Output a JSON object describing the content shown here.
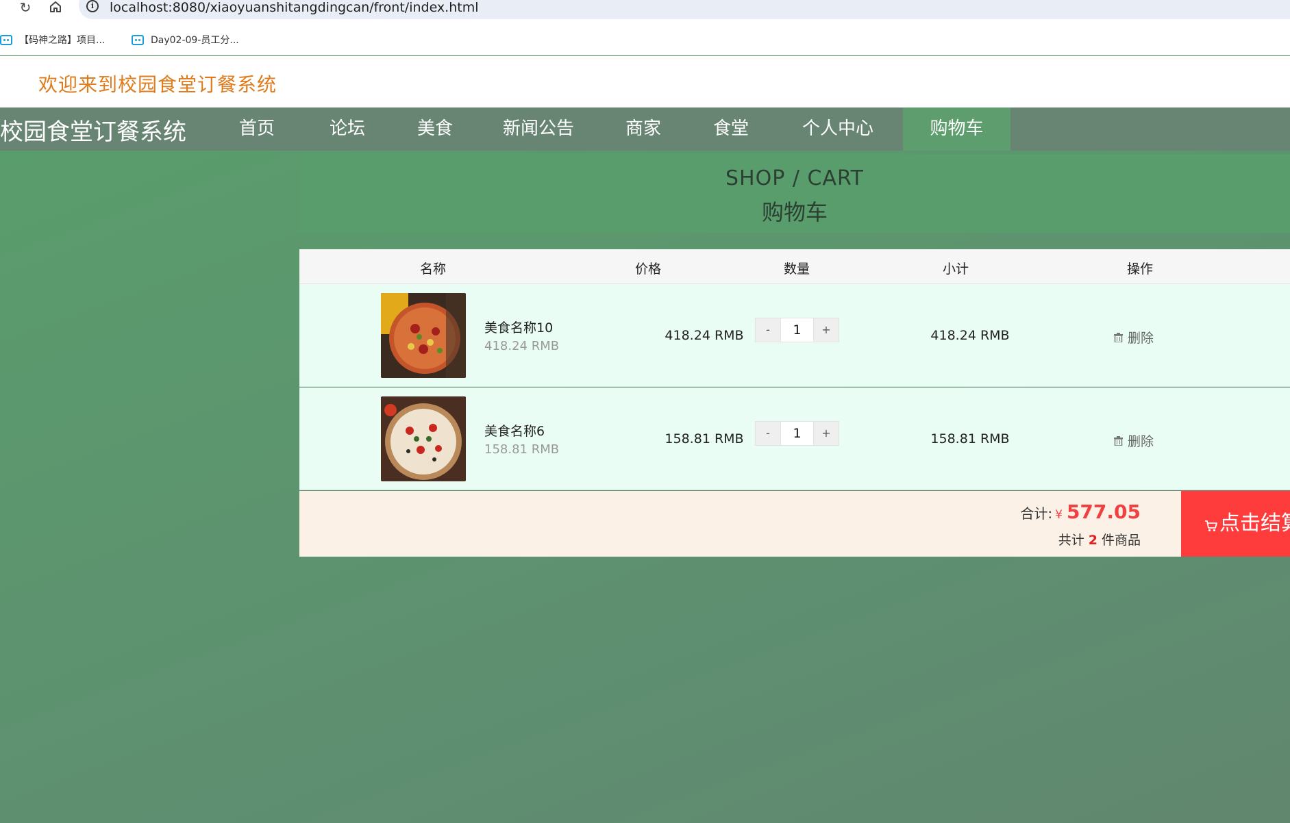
{
  "browser": {
    "url": "localhost:8080/xiaoyuanshitangdingcan/front/index.html",
    "bookmarks": [
      {
        "label": "【码神之路】项目..."
      },
      {
        "label": "Day02-09-员工分..."
      }
    ]
  },
  "site": {
    "welcome": "欢迎来到校园食堂订餐系统",
    "brand": "校园食堂订餐系统",
    "nav": [
      "首页",
      "论坛",
      "美食",
      "新闻公告",
      "商家",
      "食堂",
      "个人中心",
      "购物车"
    ],
    "active_nav": "购物车"
  },
  "page": {
    "title_en": "SHOP / CART",
    "title_cn": "购物车"
  },
  "cart": {
    "columns": [
      "名称",
      "价格",
      "数量",
      "小计",
      "操作"
    ],
    "items": [
      {
        "name": "美食名称10",
        "unit_price": "418.24 RMB",
        "price": "418.24 RMB",
        "qty": "1",
        "subtotal": "418.24 RMB",
        "delete_label": "删除",
        "minus": "-",
        "plus": "+"
      },
      {
        "name": "美食名称6",
        "unit_price": "158.81 RMB",
        "price": "158.81 RMB",
        "qty": "1",
        "subtotal": "158.81 RMB",
        "delete_label": "删除",
        "minus": "-",
        "plus": "+"
      }
    ],
    "total_label": "合计:",
    "currency": "¥",
    "total": "577.05",
    "count_prefix": "共计",
    "count": "2",
    "count_suffix": "件商品",
    "checkout_label": "点击结算"
  },
  "colors": {
    "accent_green": "#5a9d6c",
    "navbar": "#688574",
    "checkout": "#ff3c3c",
    "welcome": "#e07b1c"
  }
}
